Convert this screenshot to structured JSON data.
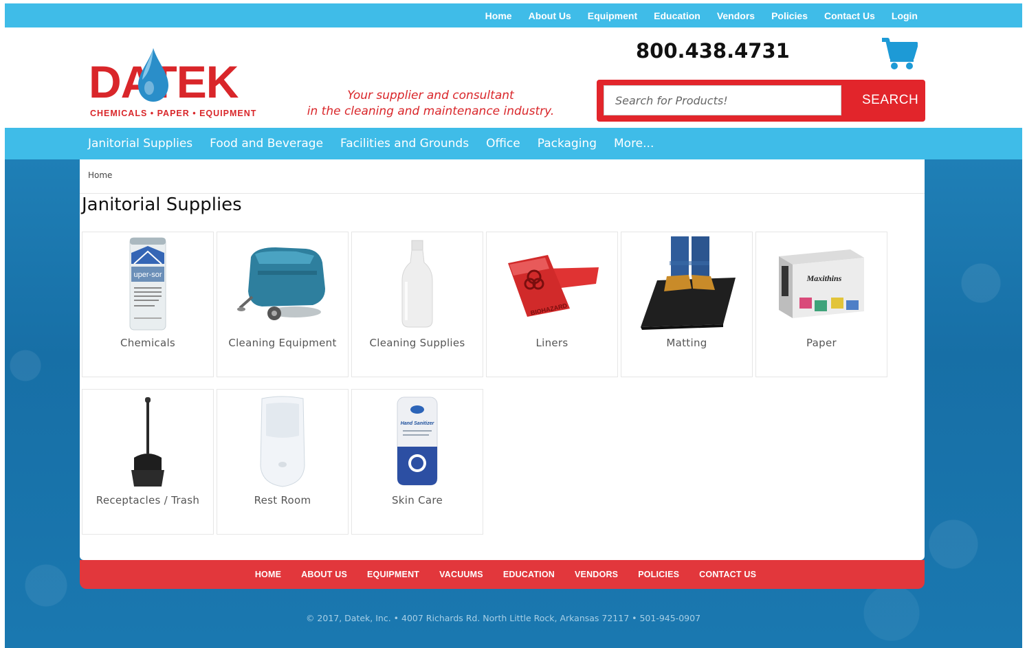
{
  "topnav": [
    "Home",
    "About Us",
    "Equipment",
    "Education",
    "Vendors",
    "Policies",
    "Contact Us",
    "Login"
  ],
  "logo": {
    "name": "DATEK",
    "tagline": "CHEMICALS • PAPER • EQUIPMENT"
  },
  "tagline": {
    "line1": "Your supplier and consultant",
    "line2": "in the cleaning and maintenance industry."
  },
  "phone": "800.438.4731",
  "search": {
    "placeholder": "Search for Products!",
    "button": "SEARCH"
  },
  "mainnav": [
    "Janitorial Supplies",
    "Food and Beverage",
    "Facilities and Grounds",
    "Office",
    "Packaging",
    "More..."
  ],
  "breadcrumb": "Home",
  "page_title": "Janitorial Supplies",
  "categories": [
    "Chemicals",
    "Cleaning Equipment",
    "Cleaning Supplies",
    "Liners",
    "Matting",
    "Paper",
    "Receptacles / Trash",
    "Rest Room",
    "Skin Care"
  ],
  "product_text": {
    "chemicals_can": "uper-sor",
    "liner_text": "BIOHAZARD",
    "paper_brand": "Maxithins",
    "sanitizer_text": "Hand Sanitizer"
  },
  "footnav": [
    "HOME",
    "ABOUT US",
    "EQUIPMENT",
    "VACUUMS",
    "EDUCATION",
    "VENDORS",
    "POLICIES",
    "CONTACT US"
  ],
  "copyright": "© 2017, Datek, Inc. • 4007 Richards Rd. North Little Rock, Arkansas 72117 • 501-945-0907",
  "colors": {
    "brand_red": "#d9262a",
    "nav_blue": "#3fbce8",
    "ocean_blue": "#1a78b0",
    "footer_red": "#e2373c"
  }
}
